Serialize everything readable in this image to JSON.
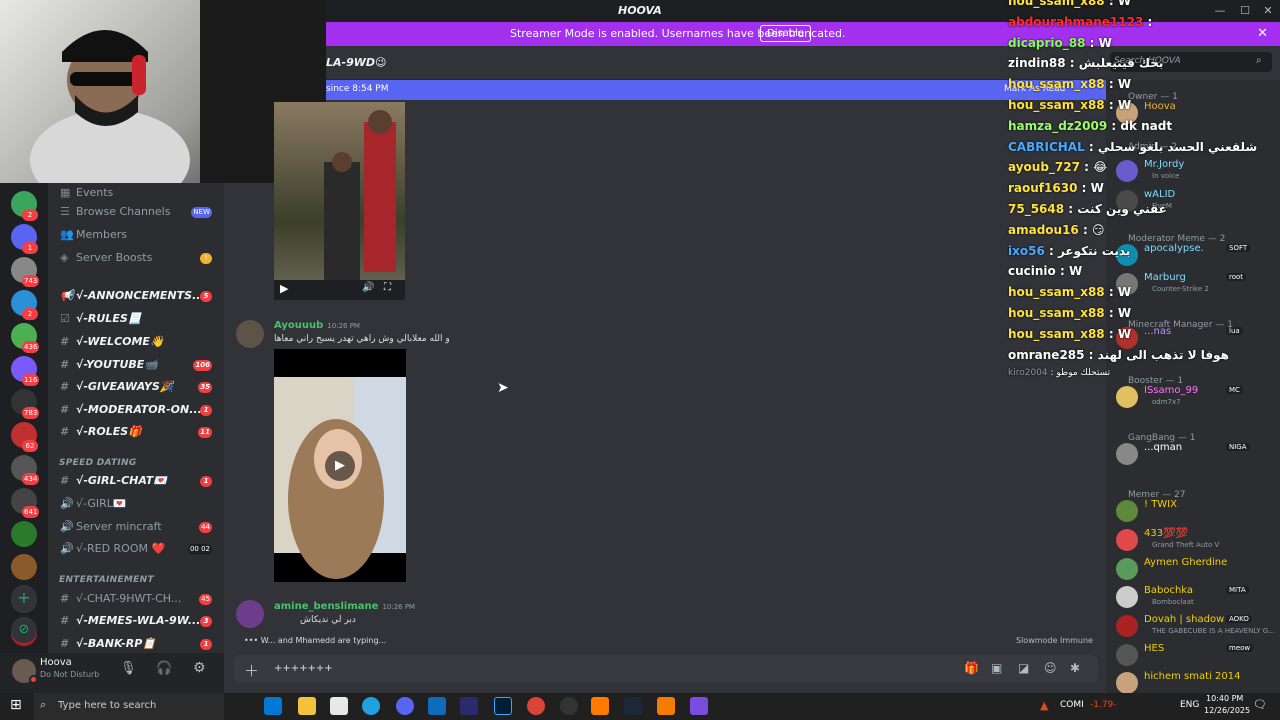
{
  "app": {
    "title": "HOOVA",
    "streamer_banner": "Streamer Mode is enabled. Usernames have been truncated.",
    "disable_label": "Disable",
    "close_glyph": "✕"
  },
  "window": {
    "min": "—",
    "max": "☐",
    "close": "✕"
  },
  "guild_badges": [
    "2",
    "1",
    "743",
    "2",
    "436",
    "116",
    "783",
    "62",
    "434",
    "641"
  ],
  "channels": {
    "items": [
      {
        "label": "Events",
        "icon": "calendar-icon",
        "style": "plain"
      },
      {
        "label": "Browse Channels",
        "icon": "browse-icon",
        "style": "plain",
        "tag": "NEW"
      },
      {
        "label": "Members",
        "icon": "members-icon",
        "style": "plain"
      },
      {
        "label": "Server Boosts",
        "icon": "boost-icon",
        "style": "plain",
        "alert": "!"
      },
      {
        "label": "√-ANNONCEMENTS...",
        "icon": "megaphone-icon",
        "style": "bold",
        "badge": "5"
      },
      {
        "label": "√-RULES📃",
        "icon": "rules-icon",
        "style": "bold"
      },
      {
        "label": "√-WELCOME👋",
        "icon": "hash-icon",
        "style": "bold"
      },
      {
        "label": "√-YOUTUBE📹",
        "icon": "hash-icon",
        "style": "bold",
        "badge": "106"
      },
      {
        "label": "√-GIVEAWAYS🎉",
        "icon": "hash-icon",
        "style": "bold",
        "badge": "35"
      },
      {
        "label": "√-MODERATOR-ON...",
        "icon": "hash-icon",
        "style": "bold",
        "badge": "1"
      },
      {
        "label": "√-ROLES🎁",
        "icon": "hash-icon",
        "style": "bold",
        "badge": "11"
      }
    ],
    "cat_speed": "SPEED DATING",
    "speed": [
      {
        "label": "√-GIRL-CHAT💌",
        "icon": "hash-icon",
        "style": "bold",
        "badge": "1"
      },
      {
        "label": "√-GIRL💌",
        "icon": "speaker-icon",
        "style": "plain"
      },
      {
        "label": "Server mincraft",
        "icon": "speaker-icon",
        "style": "plain",
        "badge": "44"
      },
      {
        "label": "√-RED ROOM ❤️",
        "icon": "speaker-icon",
        "style": "plain",
        "extra": "00 02"
      }
    ],
    "cat_ent": "ENTERTAINEMENT",
    "ent": [
      {
        "label": "√-CHAT-9HWT-CH...",
        "icon": "hash-icon",
        "style": "plain",
        "badge": "45"
      },
      {
        "label": "√-MEMES-WLA-9W...",
        "icon": "hash-icon",
        "style": "bold",
        "badge": "3"
      },
      {
        "label": "√-BANK-RP📋",
        "icon": "hash-icon",
        "style": "bold",
        "badge": "1"
      }
    ]
  },
  "user": {
    "name": "Hoova",
    "status": "Do Not Disturb"
  },
  "chat": {
    "header": "LA-9WD😉",
    "mark_text": "since 8:54 PM",
    "mark_read": "Mark As Read",
    "messages": [
      {
        "author": "Ayouuub",
        "time": "10:26 PM",
        "text": "و الله معلابالي وش راهي تهدر يسبح راني معاها"
      },
      {
        "author": "amine_benslimane",
        "time": "10:26 PM",
        "text": "دبر لي نديكاش"
      }
    ],
    "typing": "W... and Mhamedd are typing...",
    "slowmode": "Slowmode Immune",
    "composer_text": "+++++++"
  },
  "overlay": [
    {
      "user": "hou_ssam_x88",
      "msg": "W",
      "color": "#ffe23c"
    },
    {
      "user": "abdourahmane1123",
      "msg": "",
      "color": "#ff2b2b"
    },
    {
      "user": "dicaprio_88",
      "msg": "W",
      "color": "#7fff4f"
    },
    {
      "user": "zindin88",
      "msg": "بحك قيتيعلبش",
      "color": "#ffffff"
    },
    {
      "user": "hou_ssam_x88",
      "msg": "W",
      "color": "#ffe23c"
    },
    {
      "user": "hou_ssam_x88",
      "msg": "W",
      "color": "#ffe23c"
    },
    {
      "user": "hamza_dz2009",
      "msg": "dk nadt",
      "color": "#9cff6a"
    },
    {
      "user": "CABRICHAL",
      "msg": "شلقعني الحسد بلغو سحلي",
      "color": "#4aa8ff"
    },
    {
      "user": "ayoub_727",
      "msg": "😂",
      "color": "#ffe23c"
    },
    {
      "user": "raouf1630",
      "msg": "W",
      "color": "#ffe23c"
    },
    {
      "user": "75_5648",
      "msg": "عقني وين كنت",
      "color": "#ffe23c"
    },
    {
      "user": "amadou16",
      "msg": "😏",
      "color": "#ffe23c"
    },
    {
      "user": "ixo56",
      "msg": "بديت نتكوعر",
      "color": "#4aa8ff"
    },
    {
      "user": "cucinio",
      "msg": "W",
      "color": "#ffffff"
    },
    {
      "user": "hou_ssam_x88",
      "msg": "W",
      "color": "#ffe23c"
    },
    {
      "user": "hou_ssam_x88",
      "msg": "W",
      "color": "#ffe23c"
    },
    {
      "user": "hou_ssam_x88",
      "msg": "W",
      "color": "#ffe23c"
    },
    {
      "user": "omrane285",
      "msg": "هوفا لا تذهب الى لهند",
      "color": "#ffffff"
    },
    {
      "user": "kiro2004",
      "msg": "تستحلك موطو",
      "color": "#8899aa"
    }
  ],
  "members": {
    "search_placeholder": "Search HOOVA",
    "sections": [
      {
        "title": "Owner — 1",
        "members": [
          {
            "name": "Hoova",
            "color": "#f0b232"
          }
        ]
      },
      {
        "title": "Admin — 2",
        "members": [
          {
            "name": "Mr.Jordy",
            "sub": "In voice",
            "color": "#7fdcff"
          },
          {
            "name": "wALID",
            "sub": "FiveM",
            "color": "#7fdcff"
          }
        ]
      },
      {
        "title": "Moderator Meme — 2",
        "members": [
          {
            "name": "apocalypse.",
            "tag": "SOFT",
            "color": "#7fdcff"
          },
          {
            "name": "Marburg",
            "tag": "root",
            "sub": "Counter-Strike 2",
            "color": "#7fdcff"
          }
        ]
      },
      {
        "title": "Minecraft Manager — 1",
        "members": [
          {
            "name": "...nas",
            "tag": "lua",
            "color": "#c58cff"
          }
        ]
      },
      {
        "title": "Booster — 1",
        "members": [
          {
            "name": "ISsamo_99",
            "tag": "MC",
            "sub": "odm7x7",
            "color": "#ff73fa"
          }
        ]
      },
      {
        "title": "GangBang — 1",
        "members": [
          {
            "name": "...qman",
            "tag": "NIGA",
            "color": "#ffffff"
          }
        ]
      },
      {
        "title": "Memer — 27",
        "members": [
          {
            "name": "! TWIX",
            "color": "#f0d000"
          },
          {
            "name": "433💯💯",
            "sub": "Grand Theft Auto V",
            "color": "#f0d000"
          },
          {
            "name": "Aymen Gherdine",
            "color": "#f0d000"
          },
          {
            "name": "Babochka",
            "tag": "MITA",
            "sub": "Bomboclaat",
            "color": "#f0d000"
          },
          {
            "name": "Dovah | shadow ...",
            "tag": "AOKO",
            "sub": "THE GABECUBE IS A HEAVENLY G...",
            "color": "#f0d000"
          },
          {
            "name": "HES",
            "tag": "meow",
            "color": "#f0d000"
          },
          {
            "name": "hichem smati 2014",
            "color": "#f0d000"
          }
        ]
      }
    ]
  },
  "taskbar": {
    "search": "Type here to search",
    "clock": "10:40 PM",
    "date": "12/26/2025",
    "lang": "ENG",
    "ticker": "COMI",
    "ticker_val": "-1.79-"
  },
  "colors": {
    "banner": "#a330ee",
    "blurple": "#5865f2",
    "badge": "#f23f43"
  }
}
